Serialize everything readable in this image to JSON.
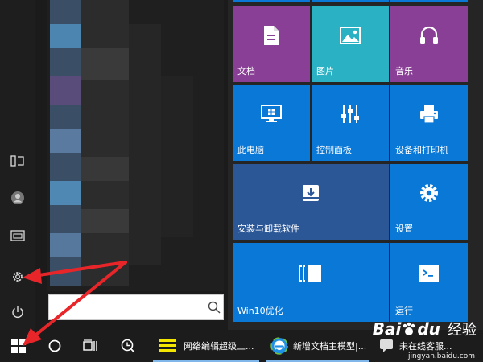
{
  "tiles": [
    {
      "label": "文档",
      "color": "#8a3f96",
      "icon": "document-icon"
    },
    {
      "label": "图片",
      "color": "#2ab2c4",
      "icon": "picture-icon"
    },
    {
      "label": "音乐",
      "color": "#8a3f96",
      "icon": "headphones-icon"
    },
    {
      "label": "此电脑",
      "color": "#0a78d7",
      "icon": "computer-icon"
    },
    {
      "label": "控制面板",
      "color": "#0a78d7",
      "icon": "control-panel-icon"
    },
    {
      "label": "设备和打印机",
      "color": "#0a78d7",
      "icon": "printer-icon"
    },
    {
      "label": "安装与卸载软件",
      "color": "#2b5797",
      "icon": "install-icon"
    },
    {
      "label": "设置",
      "color": "#0a78d7",
      "icon": "gear-icon"
    },
    {
      "label": "Win10优化",
      "color": "#0a78d7",
      "icon": "optimize-icon"
    },
    {
      "label": "运行",
      "color": "#0a78d7",
      "icon": "run-icon"
    }
  ],
  "search": {
    "placeholder": "",
    "value": ""
  },
  "taskbar": {
    "apps": [
      {
        "label": "网络编辑超级工..."
      },
      {
        "label": "新增文档主模型|..."
      },
      {
        "label": "未在线客服..."
      }
    ]
  },
  "watermark": {
    "brand": "Bai",
    "brand2": "du",
    "product": "经验",
    "site": "jingyan.baidu.com"
  },
  "colors": {
    "accent": "#0a78d7",
    "arrow": "#e8262a"
  }
}
